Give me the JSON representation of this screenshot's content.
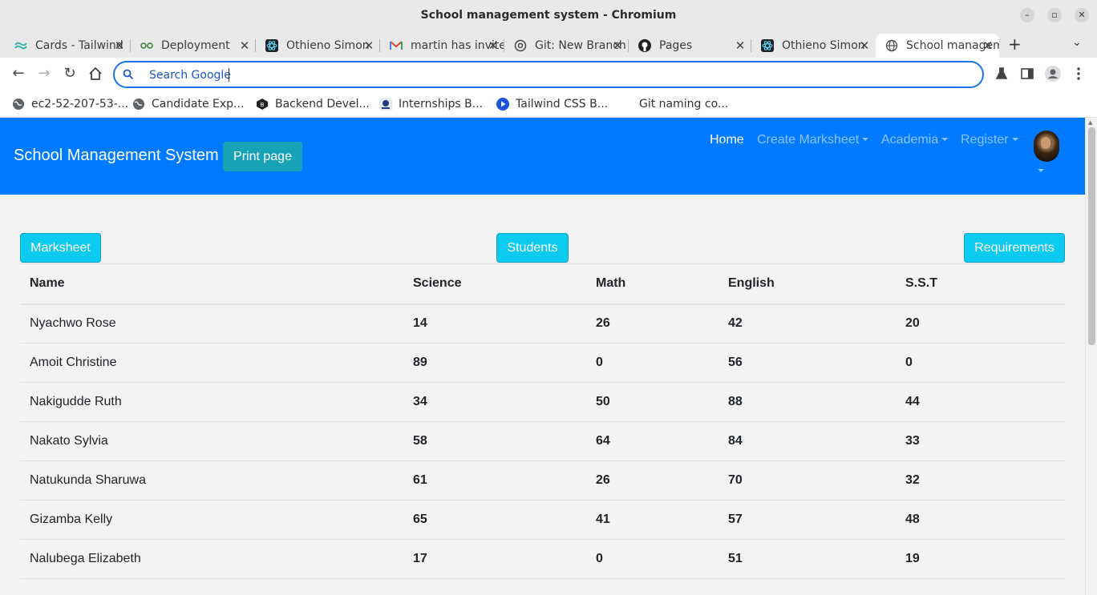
{
  "window": {
    "title": "School management system - Chromium",
    "minimize": "–",
    "restore": "▫",
    "close": "✕"
  },
  "tabs": [
    {
      "label": "Cards - Tailwind",
      "icon": "tailwind-icon"
    },
    {
      "label": "Deployment",
      "icon": "deployment-icon"
    },
    {
      "label": "Othieno Simon",
      "icon": "react-icon"
    },
    {
      "label": "martin has invited",
      "icon": "gmail-icon"
    },
    {
      "label": "Git: New Branch",
      "icon": "chatgpt-icon"
    },
    {
      "label": "Pages",
      "icon": "github-icon"
    },
    {
      "label": "Othieno Simon",
      "icon": "react-icon"
    },
    {
      "label": "School management system",
      "icon": "globe-icon"
    }
  ],
  "tab_close": "✕",
  "new_tab": "+",
  "tab_menu": "⌄",
  "omnibox": {
    "text": "Search Google"
  },
  "bookmarks": [
    {
      "label": "ec2-52-207-53-...",
      "icon": "globe-icon"
    },
    {
      "label": "Candidate Exp...",
      "icon": "globe-icon"
    },
    {
      "label": "Backend Devel...",
      "icon": "badge-icon"
    },
    {
      "label": "Internships B...",
      "icon": "internships-icon"
    },
    {
      "label": "Tailwind CSS B...",
      "icon": "play-icon"
    },
    {
      "label": "Git naming co...",
      "icon": "none"
    }
  ],
  "app": {
    "brand": "School Management System",
    "print_button": "Print page",
    "nav": {
      "home": "Home",
      "create_marksheet": "Create Marksheet",
      "academia": "Academia",
      "register": "Register"
    },
    "primary_color": "#007bff"
  },
  "actions": {
    "marksheet": "Marksheet",
    "students": "Students",
    "requirements": "Requirements"
  },
  "table": {
    "headers": [
      "Name",
      "Science",
      "Math",
      "English",
      "S.S.T"
    ],
    "rows": [
      [
        "Nyachwo Rose",
        "14",
        "26",
        "42",
        "20"
      ],
      [
        "Amoit Christine",
        "89",
        "0",
        "56",
        "0"
      ],
      [
        "Nakigudde Ruth",
        "34",
        "50",
        "88",
        "44"
      ],
      [
        "Nakato Sylvia",
        "58",
        "64",
        "84",
        "33"
      ],
      [
        "Natukunda Sharuwa",
        "61",
        "26",
        "70",
        "32"
      ],
      [
        "Gizamba Kelly",
        "65",
        "41",
        "57",
        "48"
      ],
      [
        "Nalubega Elizabeth",
        "17",
        "0",
        "51",
        "19"
      ]
    ]
  }
}
